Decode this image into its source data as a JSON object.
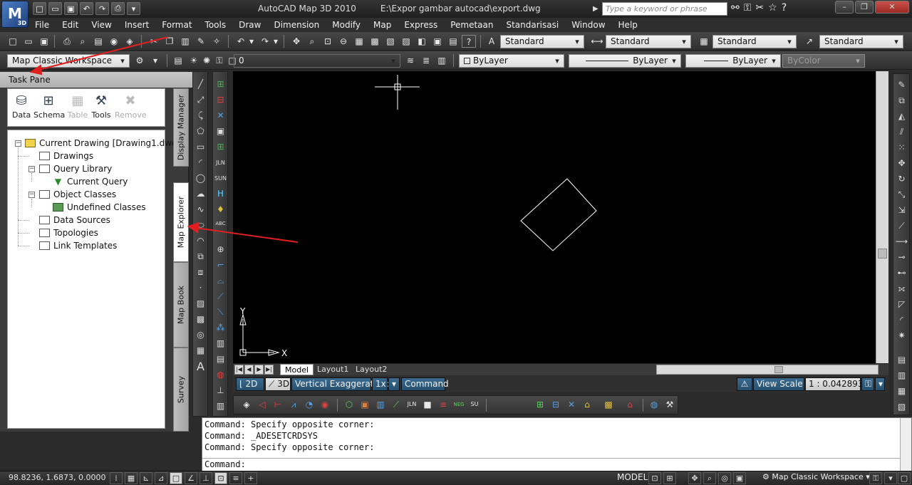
{
  "titlebar": {
    "app_badge": "3D",
    "app_name": "AutoCAD Map 3D 2010",
    "file_path": "E:\\Expor gambar autocad\\export.dwg",
    "search_placeholder": "Type a keyword or phrase"
  },
  "menu": [
    "File",
    "Edit",
    "View",
    "Insert",
    "Format",
    "Tools",
    "Draw",
    "Dimension",
    "Modify",
    "Map",
    "Express",
    "Pemetaan",
    "Standarisasi",
    "Window",
    "Help"
  ],
  "styles_toolbar": {
    "text_style": "Standard",
    "dim_style": "Standard",
    "table_style": "Standard",
    "multileader_style": "Standard"
  },
  "layers_toolbar": {
    "workspace": "Map Classic Workspace",
    "layer": "0",
    "color": "ByLayer",
    "linetype": "ByLayer",
    "lineweight": "ByLayer",
    "plot_style": "ByColor"
  },
  "task_pane": {
    "title": "Task Pane",
    "tools": [
      {
        "label": "Data",
        "enabled": true
      },
      {
        "label": "Schema",
        "enabled": true
      },
      {
        "label": "Table",
        "enabled": false
      },
      {
        "label": "Tools",
        "enabled": true
      },
      {
        "label": "Remove",
        "enabled": false
      }
    ],
    "tree": {
      "root": "Current Drawing [Drawing1.dwg]",
      "drawings": "Drawings",
      "query_library": "Query Library",
      "current_query": "Current Query",
      "object_classes": "Object Classes",
      "undefined_classes": "Undefined Classes",
      "data_sources": "Data Sources",
      "topologies": "Topologies",
      "link_templates": "Link Templates"
    },
    "vertical_tabs": [
      "Display Manager",
      "Map Explorer",
      "Map Book",
      "Survey"
    ],
    "active_tab": "Map Explorer"
  },
  "left_strip_labels": [
    "JLN",
    "SUN",
    "H",
    "ABC"
  ],
  "canvas": {
    "background": "#000000",
    "ucs_x": "X",
    "ucs_y": "Y"
  },
  "layout_tabs": [
    "Model",
    "Layout1",
    "Layout2"
  ],
  "map_status": {
    "btn_2d": "2D",
    "btn_3d": "3D",
    "vertical_exaggeration_label": "Vertical Exaggeration:",
    "vertical_exaggeration_value": "1x",
    "command_btn": "Command",
    "view_scale_label": "View Scale",
    "view_scale_value": "1 : 0.0428938"
  },
  "map_toolbar_labels": [
    "JLN",
    "NEG",
    "SU"
  ],
  "command": {
    "lines": [
      "Command: Specify opposite corner:",
      "Command: _ADESETCRDSYS",
      "Command: Specify opposite corner:"
    ],
    "prompt": "Command:"
  },
  "statusbar": {
    "coords": "98.8236, 1.6873, 0.0000",
    "model": "MODEL",
    "workspace": "Map Classic Workspace"
  },
  "accent": {
    "arrow_red": "#e02020",
    "active_blue": "#2a5a80"
  }
}
